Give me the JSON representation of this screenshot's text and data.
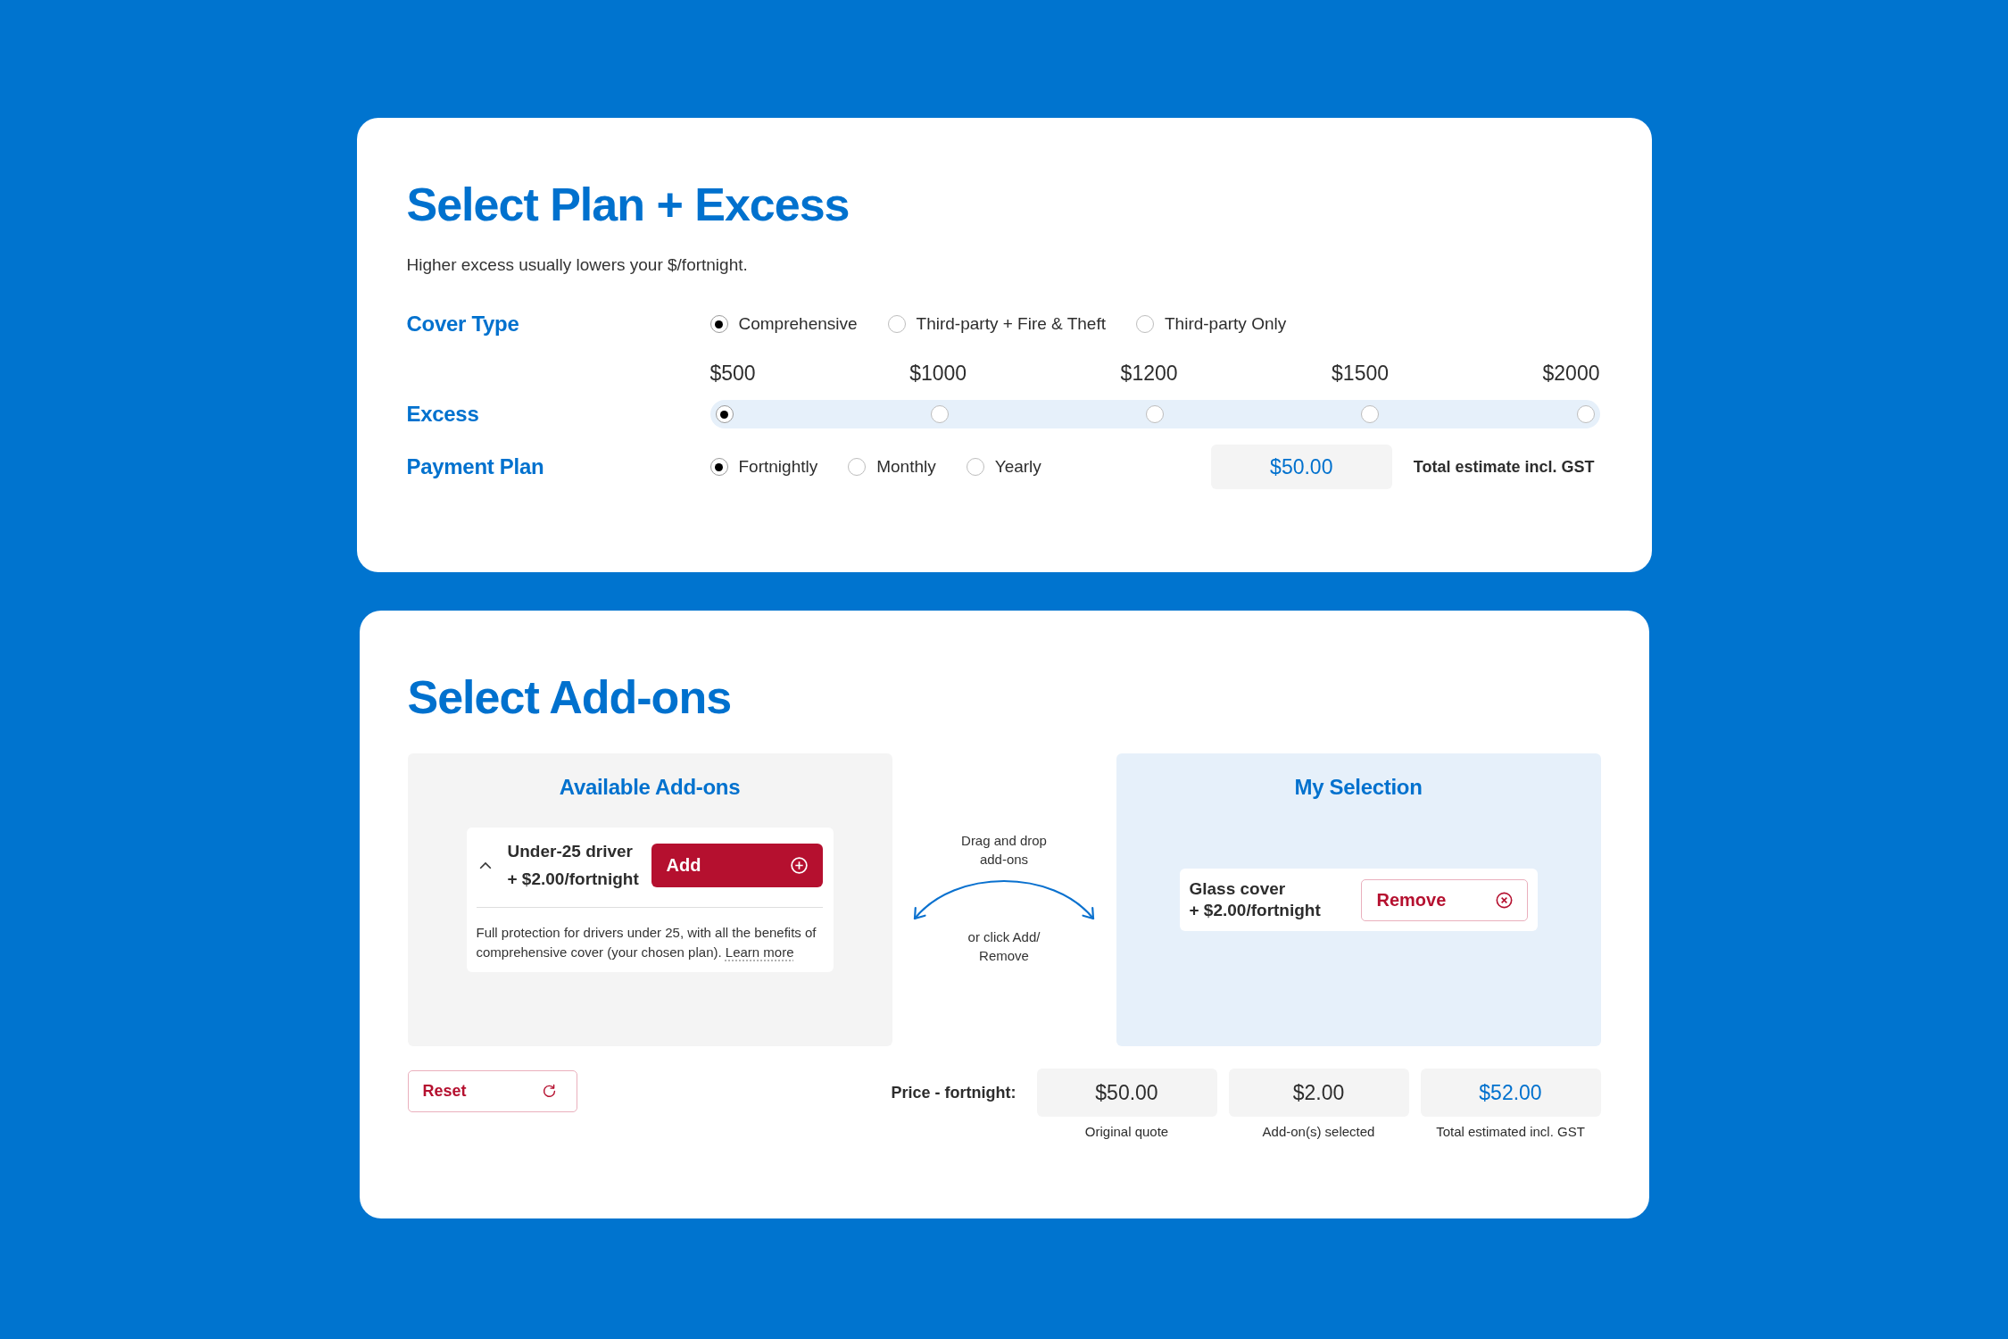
{
  "plan_card": {
    "title": "Select Plan + Excess",
    "subtitle": "Higher excess usually lowers your $/fortnight.",
    "cover_type": {
      "label": "Cover Type",
      "options": [
        {
          "label": "Comprehensive",
          "selected": true
        },
        {
          "label": "Third-party + Fire & Theft",
          "selected": false
        },
        {
          "label": "Third-party Only",
          "selected": false
        }
      ]
    },
    "excess": {
      "label": "Excess",
      "options": [
        {
          "label": "$500",
          "selected": true
        },
        {
          "label": "$1000",
          "selected": false
        },
        {
          "label": "$1200",
          "selected": false
        },
        {
          "label": "$1500",
          "selected": false
        },
        {
          "label": "$2000",
          "selected": false
        }
      ]
    },
    "payment_plan": {
      "label": "Payment Plan",
      "options": [
        {
          "label": "Fortnightly",
          "selected": true
        },
        {
          "label": "Monthly",
          "selected": false
        },
        {
          "label": "Yearly",
          "selected": false
        }
      ],
      "total": {
        "value": "$50.00",
        "caption": "Total estimate incl. GST"
      }
    }
  },
  "addons_card": {
    "title": "Select Add-ons",
    "available": {
      "title": "Available Add-ons",
      "items": [
        {
          "name": "Under-25 driver",
          "price": "+ $2.00/fortnight",
          "expanded": true,
          "button": "Add",
          "description": "Full protection for drivers under 25, with all the benefits of comprehensive cover (your chosen plan).",
          "link": "Learn more"
        }
      ]
    },
    "hint": {
      "drag": "Drag and drop add-ons",
      "click": "or click Add/ Remove"
    },
    "selection": {
      "title": "My Selection",
      "items": [
        {
          "name": "Glass cover",
          "price": "+ $2.00/fortnight",
          "button": "Remove"
        }
      ]
    },
    "reset_button": "Reset",
    "price": {
      "label": "Price - fortnight:",
      "boxes": [
        {
          "kind": "amount",
          "value": "$50.00",
          "caption": "Original quote"
        },
        {
          "kind": "amount",
          "value": "$2.00",
          "caption": "Add-on(s) selected"
        },
        {
          "kind": "total",
          "value": "$52.00",
          "caption": "Total estimated incl. GST"
        }
      ]
    }
  }
}
